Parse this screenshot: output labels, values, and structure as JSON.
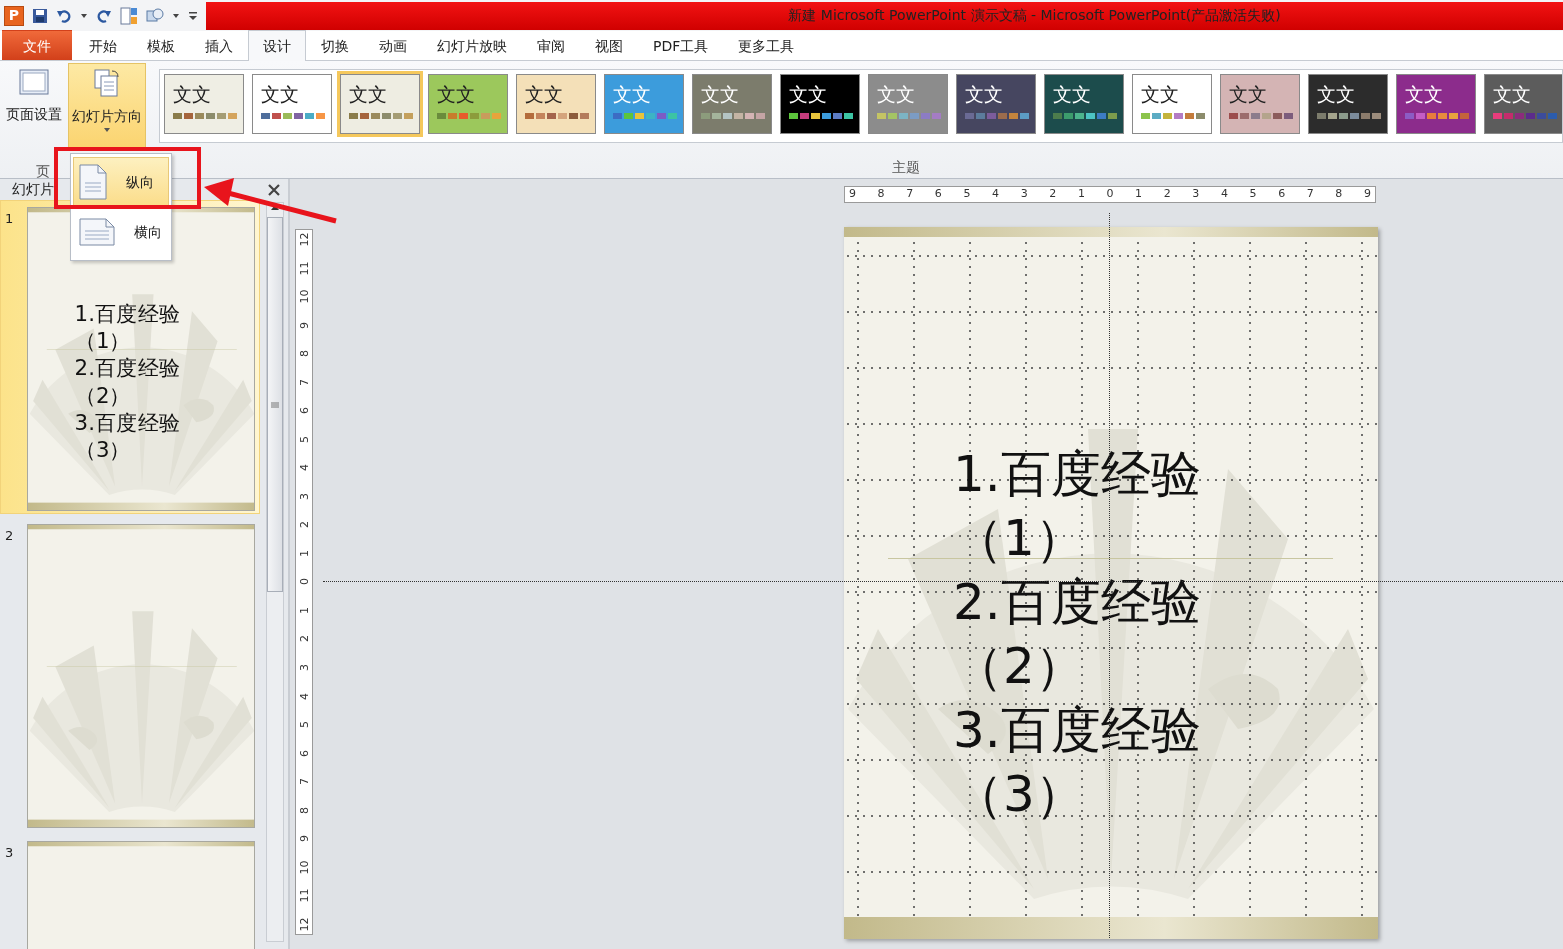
{
  "window": {
    "app_letter": "P",
    "title": "新建 Microsoft PowerPoint 演示文稿 - Microsoft PowerPoint(产品激活失败)"
  },
  "ribbon_tabs": [
    {
      "label": "文件",
      "kind": "file",
      "selected": false
    },
    {
      "label": "开始",
      "kind": "tab",
      "selected": false
    },
    {
      "label": "模板",
      "kind": "tab",
      "selected": false
    },
    {
      "label": "插入",
      "kind": "tab",
      "selected": false
    },
    {
      "label": "设计",
      "kind": "tab",
      "selected": true
    },
    {
      "label": "切换",
      "kind": "tab",
      "selected": false
    },
    {
      "label": "动画",
      "kind": "tab",
      "selected": false
    },
    {
      "label": "幻灯片放映",
      "kind": "tab",
      "selected": false
    },
    {
      "label": "审阅",
      "kind": "tab",
      "selected": false
    },
    {
      "label": "视图",
      "kind": "tab",
      "selected": false
    },
    {
      "label": "PDF工具",
      "kind": "tab",
      "selected": false
    },
    {
      "label": "更多工具",
      "kind": "tab",
      "selected": false
    }
  ],
  "ribbon": {
    "buttons": [
      {
        "label": "页面设置",
        "pressed": false
      },
      {
        "label": "幻灯片方向",
        "pressed": true
      }
    ],
    "group_label": "页",
    "themes_label": "主题",
    "themes": [
      {
        "label": "文文",
        "color": "#efeee4",
        "selected": false,
        "swatches": [
          {
            "color": "#8a7c4a"
          },
          {
            "color": "#a5643c"
          },
          {
            "color": "#9a8a5c"
          },
          {
            "color": "#8c8c6c"
          },
          {
            "color": "#a49c74"
          },
          {
            "color": "#d4a45c"
          }
        ]
      },
      {
        "label": "文文",
        "color": "#ffffff",
        "selected": false,
        "swatches": [
          {
            "color": "#4f6e9c"
          },
          {
            "color": "#c0504d"
          },
          {
            "color": "#9bbb59"
          },
          {
            "color": "#8064a2"
          },
          {
            "color": "#4bacc6"
          },
          {
            "color": "#f79646"
          }
        ]
      },
      {
        "label": "文文",
        "color": "#eeede2",
        "selected": true,
        "swatches": [
          {
            "color": "#8a7c4a"
          },
          {
            "color": "#a5643c"
          },
          {
            "color": "#9a8a5c"
          },
          {
            "color": "#8c8c6c"
          },
          {
            "color": "#a49c74"
          },
          {
            "color": "#c4a05c"
          }
        ]
      },
      {
        "label": "文文",
        "color": "#9cc85c",
        "selected": false,
        "swatches": [
          {
            "color": "#6a8c3c"
          },
          {
            "color": "#c87c2c"
          },
          {
            "color": "#e85c2c"
          },
          {
            "color": "#8c9c3c"
          },
          {
            "color": "#c89c5c"
          },
          {
            "color": "#e8a43c"
          }
        ]
      },
      {
        "label": "文文",
        "color": "#f4e0b8",
        "selected": false,
        "swatches": [
          {
            "color": "#b46c3c"
          },
          {
            "color": "#c4845c"
          },
          {
            "color": "#a4644c"
          },
          {
            "color": "#d4a47c"
          },
          {
            "color": "#8c5c3c"
          },
          {
            "color": "#b47c5c"
          }
        ]
      },
      {
        "label": "文文",
        "color": "#3c9cdc",
        "selected": false,
        "swatches": [
          {
            "color": "#3c6cc4"
          },
          {
            "color": "#5cc43c"
          },
          {
            "color": "#e8c43c"
          },
          {
            "color": "#3cb4c4"
          },
          {
            "color": "#7c5cc4"
          },
          {
            "color": "#3cc4a4"
          }
        ]
      },
      {
        "label": "文文",
        "color": "#7c7c6c",
        "selected": false,
        "swatches": [
          {
            "color": "#8c9c7c"
          },
          {
            "color": "#a4b49c"
          },
          {
            "color": "#b4c4c4"
          },
          {
            "color": "#c4b4a4"
          },
          {
            "color": "#d4b4b4"
          },
          {
            "color": "#c4a4a4"
          }
        ]
      },
      {
        "label": "文文",
        "color": "#000000",
        "selected": false,
        "swatches": [
          {
            "color": "#5cc43c"
          },
          {
            "color": "#c43c7c"
          },
          {
            "color": "#e8c43c"
          },
          {
            "color": "#3c9cdc"
          },
          {
            "color": "#5c7cc4"
          },
          {
            "color": "#3cc4a4"
          }
        ]
      },
      {
        "label": "文文",
        "color": "#8c8c8c",
        "selected": false,
        "swatches": [
          {
            "color": "#c4c464"
          },
          {
            "color": "#a4c464"
          },
          {
            "color": "#7cb4c4"
          },
          {
            "color": "#7c9cc4"
          },
          {
            "color": "#8c7cc4"
          },
          {
            "color": "#a47cc4"
          }
        ]
      },
      {
        "label": "文文",
        "color": "#464660",
        "selected": false,
        "swatches": [
          {
            "color": "#6a6a94"
          },
          {
            "color": "#5c7c9c"
          },
          {
            "color": "#7c5c9c"
          },
          {
            "color": "#9c6c4c"
          },
          {
            "color": "#c4843c"
          },
          {
            "color": "#5c9cc4"
          }
        ]
      },
      {
        "label": "文文",
        "color": "#1c4c4c",
        "selected": false,
        "swatches": [
          {
            "color": "#4c7c4c"
          },
          {
            "color": "#3c9c6c"
          },
          {
            "color": "#4cb48c"
          },
          {
            "color": "#4cc4c4"
          },
          {
            "color": "#3c7cc4"
          },
          {
            "color": "#7c9c4c"
          }
        ]
      },
      {
        "label": "文文",
        "color": "#ffffff",
        "selected": false,
        "swatches": [
          {
            "color": "#8cc44c"
          },
          {
            "color": "#5cacc4"
          },
          {
            "color": "#c4b43c"
          },
          {
            "color": "#b47cc4"
          },
          {
            "color": "#c47c3c"
          },
          {
            "color": "#8c8c6c"
          }
        ]
      },
      {
        "label": "文文",
        "color": "#d4b4b4",
        "selected": false,
        "swatches": [
          {
            "color": "#9c4c4c"
          },
          {
            "color": "#9c6c6c"
          },
          {
            "color": "#8c7c8c"
          },
          {
            "color": "#b4a48c"
          },
          {
            "color": "#8c5c5c"
          },
          {
            "color": "#7c5c7c"
          }
        ]
      },
      {
        "label": "文文",
        "color": "#2c2c2c",
        "selected": false,
        "swatches": [
          {
            "color": "#7c7c6c"
          },
          {
            "color": "#a4a48c"
          },
          {
            "color": "#8c9c8c"
          },
          {
            "color": "#7c8c9c"
          },
          {
            "color": "#8c7c6c"
          },
          {
            "color": "#9c8c7c"
          }
        ]
      },
      {
        "label": "文文",
        "color": "#8c2c8c",
        "selected": false,
        "swatches": [
          {
            "color": "#8c5cc4"
          },
          {
            "color": "#c45cc4"
          },
          {
            "color": "#e87c3c"
          },
          {
            "color": "#e88c3c"
          },
          {
            "color": "#e8a43c"
          },
          {
            "color": "#c4643c"
          }
        ]
      },
      {
        "label": "文文",
        "color": "#5c5c5c",
        "selected": false,
        "swatches": [
          {
            "color": "#e83c7c"
          },
          {
            "color": "#c42c6c"
          },
          {
            "color": "#8c2c7c"
          },
          {
            "color": "#5c2c8c"
          },
          {
            "color": "#3c4c9c"
          },
          {
            "color": "#2c5cac"
          }
        ]
      }
    ]
  },
  "orientation_menu": {
    "items": [
      {
        "label": "纵向",
        "selected": true
      },
      {
        "label": "横向",
        "selected": false
      }
    ]
  },
  "slides_panel": {
    "title": "幻灯片",
    "slides": [
      {
        "number": "1",
        "selected": true,
        "lines": [
          "1.百度经验",
          "（1）",
          "2.百度经验",
          "（2）",
          "3.百度经验",
          "（3）"
        ]
      },
      {
        "number": "2",
        "selected": false
      },
      {
        "number": "3",
        "selected": false
      }
    ]
  },
  "rulers": {
    "horizontal": [
      "9",
      "8",
      "7",
      "6",
      "5",
      "4",
      "3",
      "2",
      "1",
      "0",
      "1",
      "2",
      "3",
      "4",
      "5",
      "6",
      "7",
      "8",
      "9"
    ],
    "vertical": [
      "12",
      "11",
      "10",
      "9",
      "8",
      "7",
      "6",
      "5",
      "4",
      "3",
      "2",
      "1",
      "0",
      "1",
      "2",
      "3",
      "4",
      "5",
      "6",
      "7",
      "8",
      "9",
      "10",
      "11",
      "12"
    ]
  },
  "slide": {
    "lines": [
      "1.百度经验",
      "（1）",
      "2.百度经验",
      "（2）",
      "3.百度经验",
      "（3）"
    ]
  }
}
